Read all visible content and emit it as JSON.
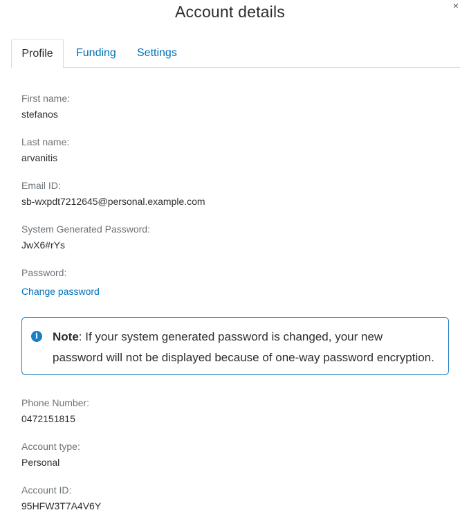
{
  "dialog": {
    "title": "Account details",
    "close_glyph": "×"
  },
  "tabs": [
    {
      "label": "Profile",
      "active": true
    },
    {
      "label": "Funding",
      "active": false
    },
    {
      "label": "Settings",
      "active": false
    }
  ],
  "profile": {
    "first_name": {
      "label": "First name:",
      "value": "stefanos"
    },
    "last_name": {
      "label": "Last name:",
      "value": "arvanitis"
    },
    "email": {
      "label": "Email ID:",
      "value": "sb-wxpdt7212645@personal.example.com"
    },
    "system_password": {
      "label": "System Generated Password:",
      "value": "JwX6#rYs"
    },
    "password": {
      "label": "Password:",
      "link": "Change password"
    },
    "phone": {
      "label": "Phone Number:",
      "value": "0472151815"
    },
    "account_type": {
      "label": "Account type:",
      "value": "Personal"
    },
    "account_id": {
      "label": "Account ID:",
      "value": "95HFW3T7A4V6Y"
    }
  },
  "note": {
    "icon": "info-icon",
    "heading": "Note",
    "body": ": If your system generated password is changed, your new password will not be displayed because of one-way password encryption."
  },
  "colors": {
    "link": "#0070ba",
    "note_border": "#1b7ec2",
    "label": "#6c7378",
    "text": "#2c2e2f"
  }
}
